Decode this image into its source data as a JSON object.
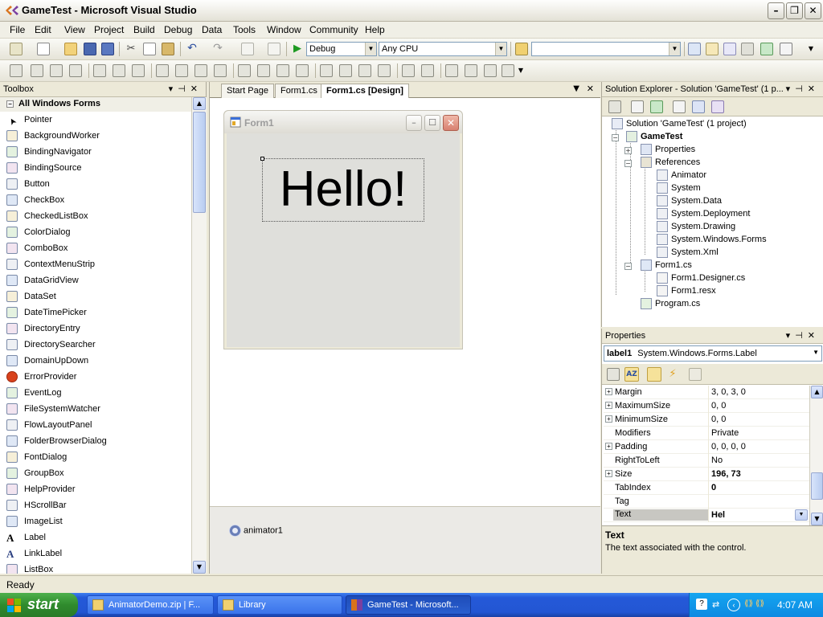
{
  "window": {
    "title": "GameTest - Microsoft Visual Studio"
  },
  "menu": [
    "File",
    "Edit",
    "View",
    "Project",
    "Build",
    "Debug",
    "Data",
    "Tools",
    "Window",
    "Community",
    "Help"
  ],
  "toolbar": {
    "config": "Debug",
    "platform": "Any CPU",
    "find": ""
  },
  "toolbox": {
    "title": "Toolbox",
    "category": "All Windows Forms",
    "items": [
      "Pointer",
      "BackgroundWorker",
      "BindingNavigator",
      "BindingSource",
      "Button",
      "CheckBox",
      "CheckedListBox",
      "ColorDialog",
      "ComboBox",
      "ContextMenuStrip",
      "DataGridView",
      "DataSet",
      "DateTimePicker",
      "DirectoryEntry",
      "DirectorySearcher",
      "DomainUpDown",
      "ErrorProvider",
      "EventLog",
      "FileSystemWatcher",
      "FlowLayoutPanel",
      "FolderBrowserDialog",
      "FontDialog",
      "GroupBox",
      "HelpProvider",
      "HScrollBar",
      "ImageList",
      "Label",
      "LinkLabel",
      "ListBox"
    ]
  },
  "tabs": [
    "Start Page",
    "Form1.cs",
    "Form1.cs [Design]"
  ],
  "form": {
    "title": "Form1",
    "label_text": "Hello!"
  },
  "tray": {
    "component": "animator1"
  },
  "solution": {
    "title": "Solution Explorer - Solution 'GameTest' (1 p...",
    "root": "Solution 'GameTest' (1 project)",
    "project": "GameTest",
    "properties": "Properties",
    "references": "References",
    "refs": [
      "Animator",
      "System",
      "System.Data",
      "System.Deployment",
      "System.Drawing",
      "System.Windows.Forms",
      "System.Xml"
    ],
    "form_file": "Form1.cs",
    "form_children": [
      "Form1.Designer.cs",
      "Form1.resx"
    ],
    "program": "Program.cs"
  },
  "properties": {
    "title": "Properties",
    "object_name": "label1",
    "object_type": "System.Windows.Forms.Label",
    "rows": [
      {
        "name": "Margin",
        "value": "3, 0, 3, 0"
      },
      {
        "name": "MaximumSize",
        "value": "0, 0"
      },
      {
        "name": "MinimumSize",
        "value": "0, 0"
      },
      {
        "name": "Modifiers",
        "value": "Private"
      },
      {
        "name": "Padding",
        "value": "0, 0, 0, 0"
      },
      {
        "name": "RightToLeft",
        "value": "No"
      },
      {
        "name": "Size",
        "value": "196, 73"
      },
      {
        "name": "TabIndex",
        "value": "0"
      },
      {
        "name": "Tag",
        "value": ""
      },
      {
        "name": "Text",
        "value": "Hel"
      }
    ],
    "desc_title": "Text",
    "desc_text": "The text associated with the control."
  },
  "status": {
    "text": "Ready"
  },
  "taskbar": {
    "start": "start",
    "tasks": [
      "AnimatorDemo.zip | F...",
      "Library",
      "GameTest - Microsoft..."
    ],
    "clock": "4:07 AM"
  },
  "colors": {
    "xp_blue": "#2459d8",
    "start_green": "#2f8b2d",
    "panel": "#ece9d8"
  }
}
